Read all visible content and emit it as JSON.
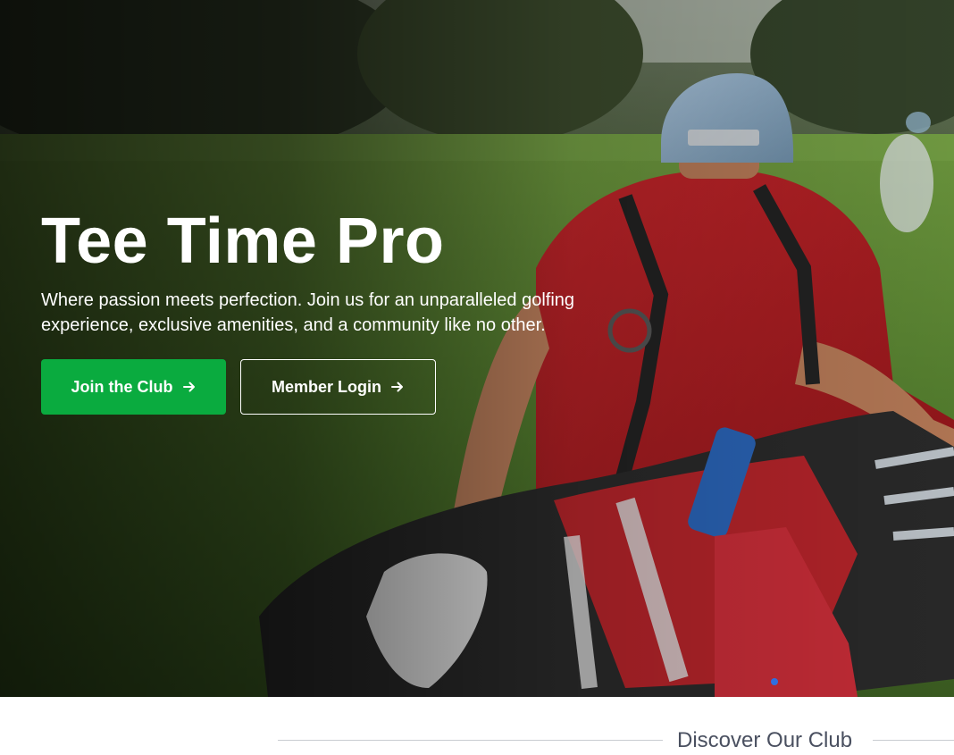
{
  "hero": {
    "title": "Tee Time Pro",
    "subtitle": "Where passion meets perfection. Join us for an unparalleled golfing experience, exclusive amenities, and a community like no other.",
    "primary_button": {
      "label": "Join the Club",
      "icon": "arrow-right-icon",
      "color": "#0aab3f"
    },
    "secondary_button": {
      "label": "Member Login",
      "icon": "arrow-right-icon"
    },
    "background": "golfer-with-red-bag-photo",
    "carousel": {
      "active_dot_color": "#2f6fe0"
    }
  },
  "discover": {
    "title": "Discover Our Club"
  }
}
